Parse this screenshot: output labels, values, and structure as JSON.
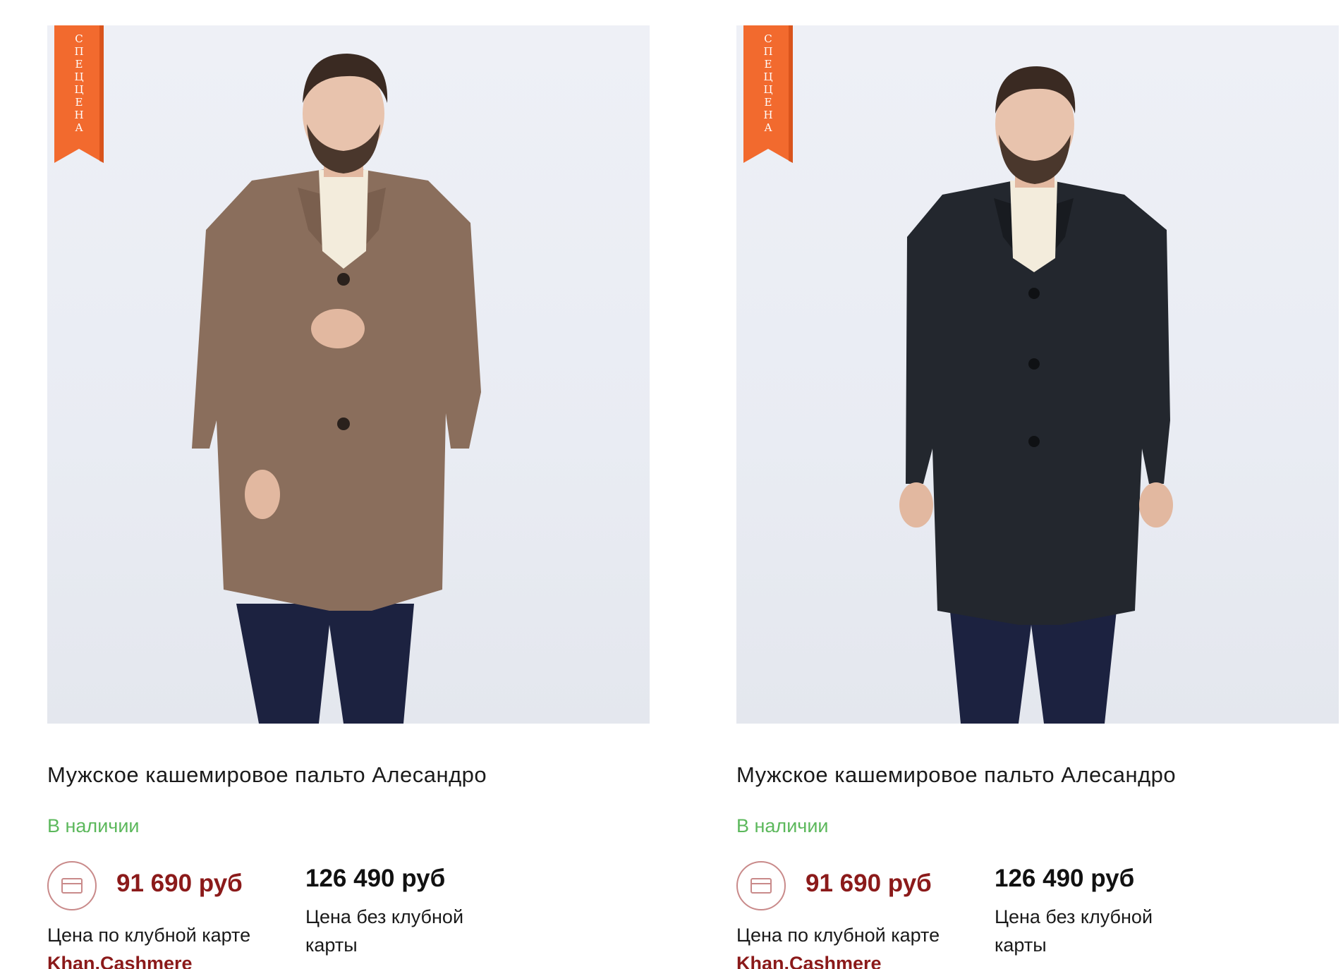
{
  "colors": {
    "accent": "#8b1a1a",
    "in_stock": "#5cb85c",
    "ribbon": "#f26a2e",
    "photo_bg": "#eceef4"
  },
  "products": [
    {
      "badge": "СПЕЦЦЕНА",
      "badge_letters": [
        "С",
        "П",
        "Е",
        "Ц",
        "Ц",
        "Е",
        "Н",
        "А"
      ],
      "coat_color": "#8a6e5c",
      "title": "Мужское кашемировое пальто Алесандро",
      "availability": "В наличии",
      "club_price": "91 690  руб",
      "club_caption": "Цена по клубной карте",
      "club_brand": "Khan.Cashmere",
      "regular_price": "126 490 руб",
      "regular_caption": "Цена без клубной карты",
      "card_icon": "credit-card-icon"
    },
    {
      "badge": "СПЕЦЦЕНА",
      "badge_letters": [
        "С",
        "П",
        "Е",
        "Ц",
        "Ц",
        "Е",
        "Н",
        "А"
      ],
      "coat_color": "#23272e",
      "title": "Мужское кашемировое пальто Алесандро",
      "availability": "В наличии",
      "club_price": "91 690  руб",
      "club_caption": "Цена по клубной карте",
      "club_brand": "Khan.Cashmere",
      "regular_price": "126 490 руб",
      "regular_caption": "Цена без клубной карты",
      "card_icon": "credit-card-icon"
    }
  ]
}
